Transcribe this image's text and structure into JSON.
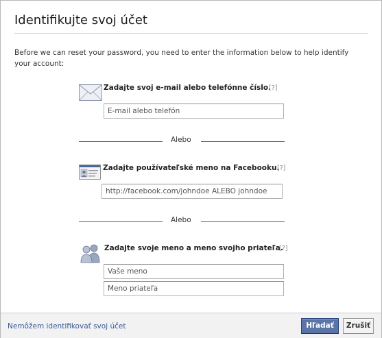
{
  "dialog": {
    "title": "Identifikujte svoj účet",
    "intro": "Before we can reset your password, you need to enter the information below to help identify your account:"
  },
  "email_section": {
    "label": "Zadajte svoj e-mail alebo telefónne číslo.",
    "help": "[?]",
    "placeholder": "E-mail alebo telefón",
    "icon": "envelope-icon"
  },
  "divider1": {
    "text": "Alebo"
  },
  "username_section": {
    "label": "Zadajte používateľské meno na Facebooku.",
    "help": "[?]",
    "placeholder": "http://facebook.com/johndoe ALEBO johndoe",
    "icon": "id-card-icon"
  },
  "divider2": {
    "text": "Alebo"
  },
  "friend_section": {
    "label": "Zadajte svoje meno a meno svojho priateľa.",
    "help": "[?]",
    "name_placeholder": "Vaše meno",
    "friend_placeholder": "Meno priateľa",
    "icon": "people-icon"
  },
  "footer": {
    "link": "Nemôžem identifikovať svoj účet",
    "search_button": "Hľadať",
    "cancel_button": "Zrušiť"
  },
  "colors": {
    "primary_button": "#5b74a8",
    "link": "#3b5998"
  }
}
